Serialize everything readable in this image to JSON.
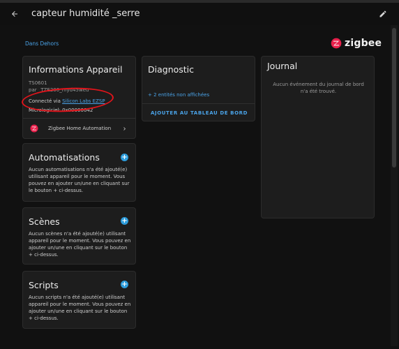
{
  "browser_tabs": [
    "",
    "",
    "",
    "",
    "",
    "",
    "",
    "",
    "",
    ""
  ],
  "header": {
    "title": "capteur humidité _serre",
    "back_icon": "arrow-left-icon",
    "edit_icon": "pencil-icon"
  },
  "breadcrumb": {
    "area_link": "Dans Dehors"
  },
  "brand": {
    "name": "zigbee",
    "color": "#e8204b"
  },
  "device_info": {
    "title": "Informations Appareil",
    "model": "TS0601",
    "manufacturer": "par _TZE200_myd45weu",
    "connected_prefix": "Connecté via",
    "connected_link": "Silicon Labs EZSP",
    "firmware": "Micrologiciel: 0x00000042",
    "integration_label": "Zigbee Home Automation"
  },
  "automations": {
    "title": "Automatisations",
    "text": "Aucun automatisations n'a été ajouté(e) utilisant appareil pour le moment. Vous pouvez en ajouter un/une en cliquant sur le bouton + ci-dessus."
  },
  "scenes": {
    "title": "Scènes",
    "text": "Aucun scènes n'a été ajouté(e) utilisant appareil pour le moment. Vous pouvez en ajouter un/une en cliquant sur le bouton + ci-dessus."
  },
  "scripts": {
    "title": "Scripts",
    "text": "Aucun scripts n'a été ajouté(e) utilisant appareil pour le moment. Vous pouvez en ajouter un/une en cliquant sur le bouton + ci-dessus."
  },
  "diagnostic": {
    "title": "Diagnostic",
    "hidden_entities": "+ 2 entités non affichées",
    "add_button": "AJOUTER AU TABLEAU DE BORD"
  },
  "journal": {
    "title": "Journal",
    "empty_text": "Aucun événement du journal de bord n'a été trouvé."
  },
  "colors": {
    "accent": "#2d9cdb",
    "link": "#4aa3e8",
    "annotation": "#e3141b"
  }
}
